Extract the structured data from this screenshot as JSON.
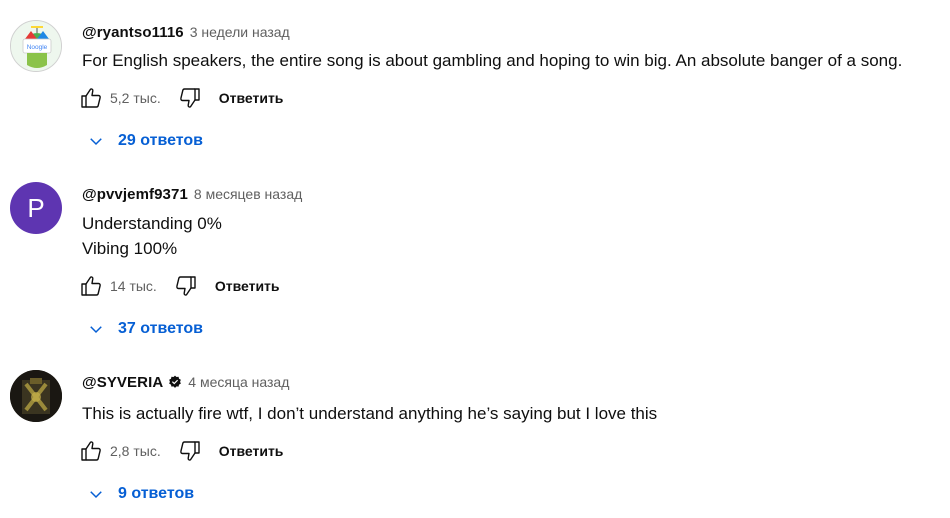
{
  "colors": {
    "link_blue": "#065fd4",
    "secondary_text": "#606060",
    "primary_text": "#0f0f0f",
    "avatar_purple": "#5e35b1"
  },
  "comments": [
    {
      "author": "@ryantso1116",
      "time": "3 недели назад",
      "text_lines": [
        "For English speakers, the entire song is about gambling and hoping to win big. An absolute banger of a song."
      ],
      "likes": "5,2 тыс.",
      "reply_label": "Ответить",
      "replies_label": "29 ответов",
      "avatar_type": "google-logo-icon",
      "avatar_logo_text": "Noogle"
    },
    {
      "author": "@pvvjemf9371",
      "time": "8 месяцев назад",
      "text_lines": [
        "Understanding 0%",
        "Vibing 100%"
      ],
      "likes": "14 тыс.",
      "reply_label": "Ответить",
      "replies_label": "37 ответов",
      "avatar_type": "letter",
      "avatar_letter": "P"
    },
    {
      "author": "@SYVERIA",
      "verified": true,
      "time": "4 месяца назад",
      "text_lines": [
        "This is actually fire wtf, I don’t understand anything he’s saying but I love this"
      ],
      "likes": "2,8 тыс.",
      "reply_label": "Ответить",
      "replies_label": "9 ответов",
      "avatar_type": "image"
    }
  ]
}
